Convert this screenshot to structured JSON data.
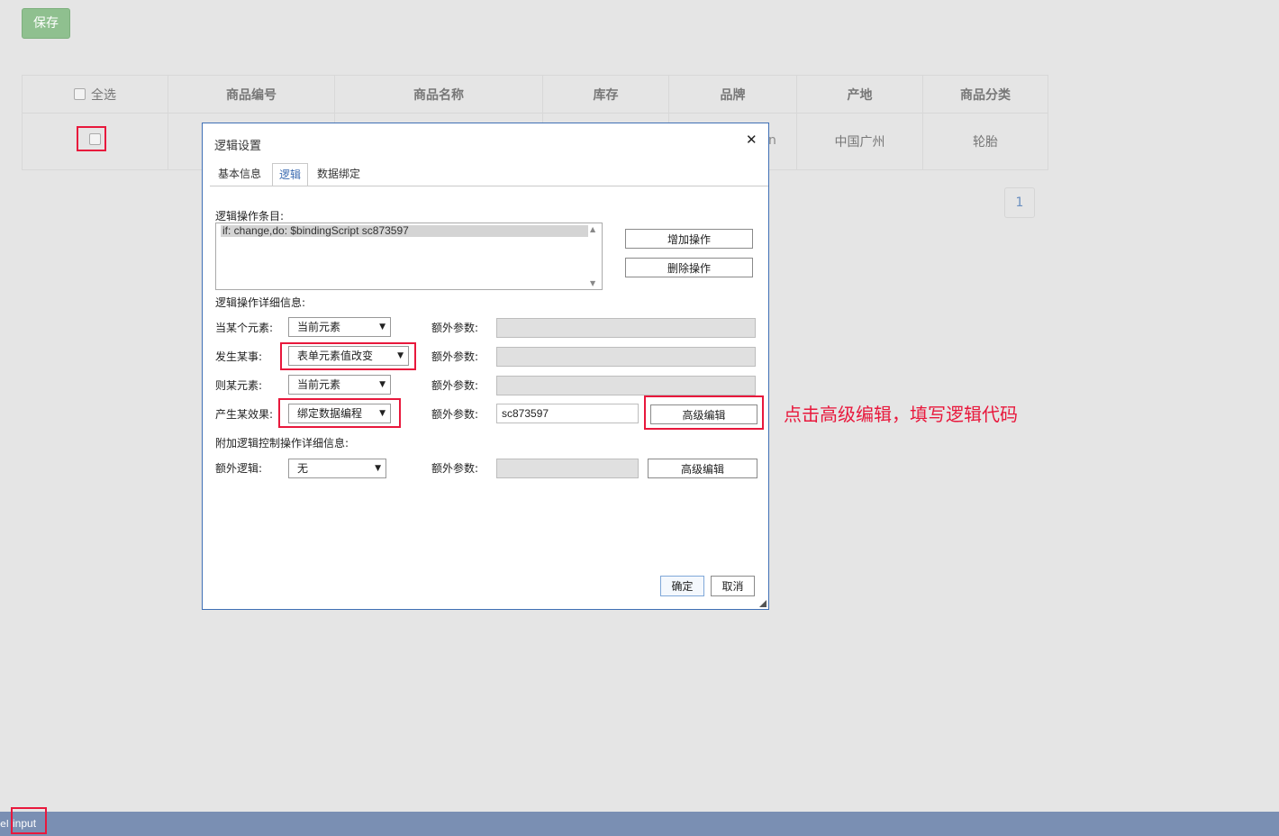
{
  "toolbar": {
    "save_label": "保存"
  },
  "table": {
    "select_all_label": "全选",
    "columns": [
      "商品编号",
      "商品名称",
      "库存",
      "品牌",
      "产地",
      "商品分类"
    ],
    "row": {
      "origin": "中国广州",
      "category": "轮胎",
      "brand_fragment": "n"
    }
  },
  "pagination": {
    "current_page": "1"
  },
  "dialog": {
    "title": "逻辑设置",
    "close_glyph": "✕",
    "tabs": [
      "基本信息",
      "逻辑",
      "数据绑定"
    ],
    "active_tab": "逻辑",
    "list_label": "逻辑操作条目:",
    "list_items": [
      "if: change,do: $bindingScript sc873597"
    ],
    "add_button": "增加操作",
    "delete_button": "删除操作",
    "detail_label": "逻辑操作详细信息:",
    "rows": [
      {
        "label": "当某个元素:",
        "select": "当前元素",
        "extra_label": "额外参数:",
        "extra_value": ""
      },
      {
        "label": "发生某事:",
        "select": "表单元素值改变",
        "extra_label": "额外参数:",
        "extra_value": ""
      },
      {
        "label": "则某元素:",
        "select": "当前元素",
        "extra_label": "额外参数:",
        "extra_value": ""
      },
      {
        "label": "产生某效果:",
        "select": "绑定数据编程",
        "extra_label": "额外参数:",
        "extra_value": "sc873597",
        "advanced_button": "高级编辑"
      }
    ],
    "extra_section_label": "附加逻辑控制操作详细信息:",
    "extra_logic": {
      "label": "额外逻辑:",
      "select": "无",
      "extra_label": "额外参数:",
      "extra_value": "",
      "advanced_button": "高级编辑"
    },
    "ok_button": "确定",
    "cancel_button": "取消"
  },
  "annotation": {
    "text": "点击高级编辑，填写逻辑代码"
  },
  "bottom_bar": {
    "left_fragment": "el",
    "input_label": "input"
  },
  "colors": {
    "highlight": "#e8183c",
    "dialog_border": "#3f6fb5",
    "bottom_bar": "#7a8fb3",
    "save_button": "#8fc08f"
  },
  "icons": {
    "close": "close-icon",
    "dropdown": "chevron-down-icon",
    "resize": "resize-grip-icon"
  }
}
